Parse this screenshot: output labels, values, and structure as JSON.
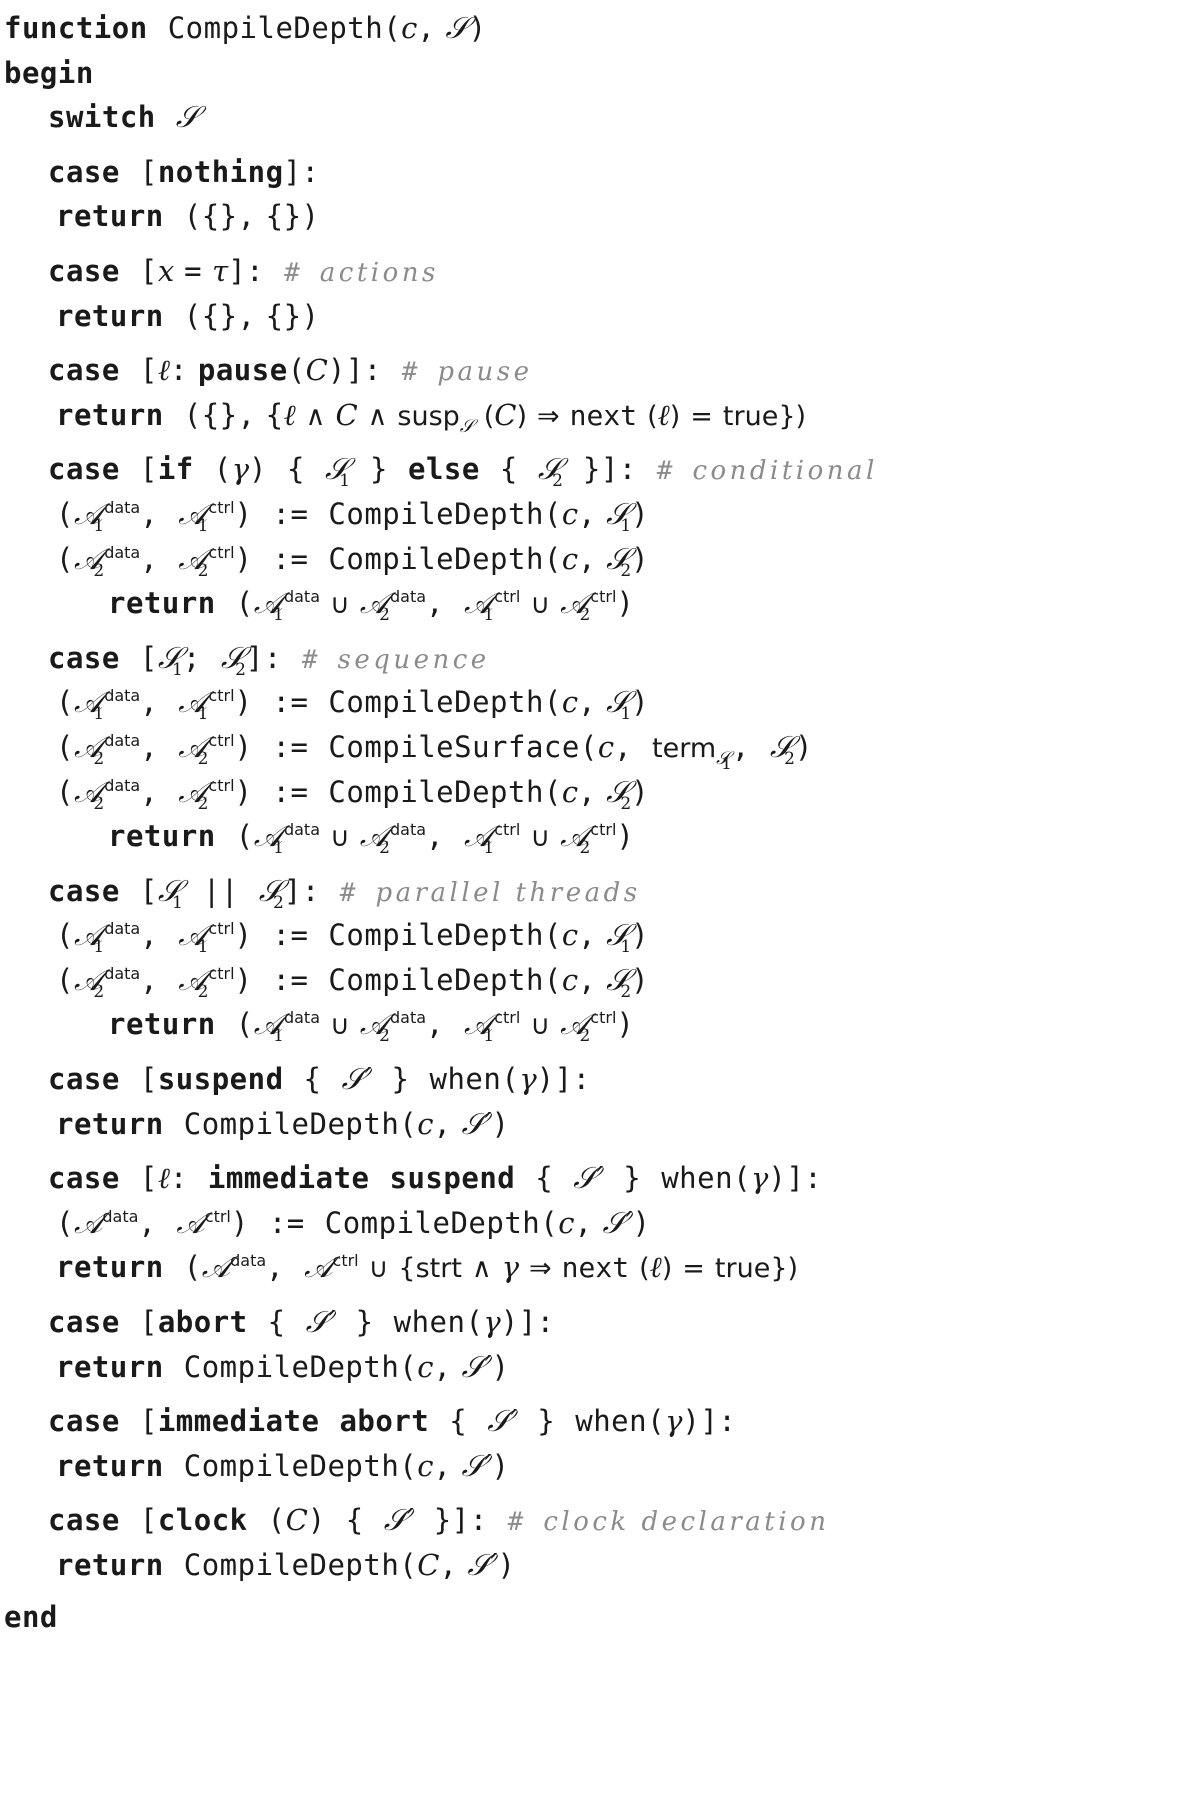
{
  "document": {
    "kind": "algorithm-pseudocode",
    "title": "CompileDepth",
    "colors": {
      "text": "#1a1a1a",
      "comment": "#8b8b8b",
      "background": "#ffffff"
    }
  },
  "keywords": {
    "function": "function",
    "begin": "begin",
    "end": "end",
    "switch": "switch",
    "case": "case",
    "return": "return",
    "if": "if",
    "else": "else",
    "nothing": "nothing",
    "pause": "pause",
    "suspend": "suspend",
    "immediate": "immediate",
    "abort": "abort",
    "clock": "clock",
    "when": "when"
  },
  "identifiers": {
    "compile_depth": "CompileDepth",
    "compile_surface": "CompileSurface",
    "susp": "susp",
    "next": "next",
    "term": "term",
    "strt": "strt",
    "true": "true",
    "assign": ":=",
    "c": "c",
    "x": "x",
    "C": "C",
    "S": "S",
    "A": "A",
    "data": "data",
    "ctrl": "ctrl",
    "one": "1",
    "two": "2"
  },
  "symbols": {
    "tau": "τ",
    "gamma": "γ",
    "ell": "ℓ",
    "and": "∧",
    "union": "∪",
    "implies": "⇒",
    "equals": "=",
    "prime": "′",
    "lbrace": "{",
    "rbrace": "}",
    "lbracket": "[",
    "rbracket": "]",
    "lparen": "(",
    "rparen": ")",
    "comma": ",",
    "colon": ":",
    "semicolon": ";",
    "parallel": "||",
    "hash": "#"
  },
  "comments": {
    "actions": "actions",
    "pause": "pause",
    "conditional": "conditional",
    "sequence": "sequence",
    "parallel_threads": "parallel threads",
    "clock_declaration": "clock declaration"
  },
  "signature": {
    "name": "CompileDepth",
    "params": "(c, S)"
  },
  "cases": [
    {
      "id": "nothing",
      "label": "[nothing]:",
      "comment": null
    },
    {
      "id": "actions",
      "label": "[x = τ]:",
      "comment": "actions"
    },
    {
      "id": "pause",
      "label": "[ℓ: pause(C)]:",
      "comment": "pause"
    },
    {
      "id": "conditional",
      "label": "[if (γ) { S1 } else { S2 }]:",
      "comment": "conditional"
    },
    {
      "id": "sequence",
      "label": "[S1 ; S2]:",
      "comment": "sequence"
    },
    {
      "id": "parallel",
      "label": "[S1 || S2]:",
      "comment": "parallel threads"
    },
    {
      "id": "suspend",
      "label": "[suspend { S′ } when(γ)]:",
      "comment": null
    },
    {
      "id": "immediate-suspend",
      "label": "[ℓ: immediate suspend { S′ } when(γ)]:",
      "comment": null
    },
    {
      "id": "abort",
      "label": "[abort { S′ } when(γ)]:",
      "comment": null
    },
    {
      "id": "immediate-abort",
      "label": "[immediate abort { S′ } when(γ)]:",
      "comment": null
    },
    {
      "id": "clock",
      "label": "[clock (C) { S′ }]:",
      "comment": "clock declaration"
    }
  ]
}
